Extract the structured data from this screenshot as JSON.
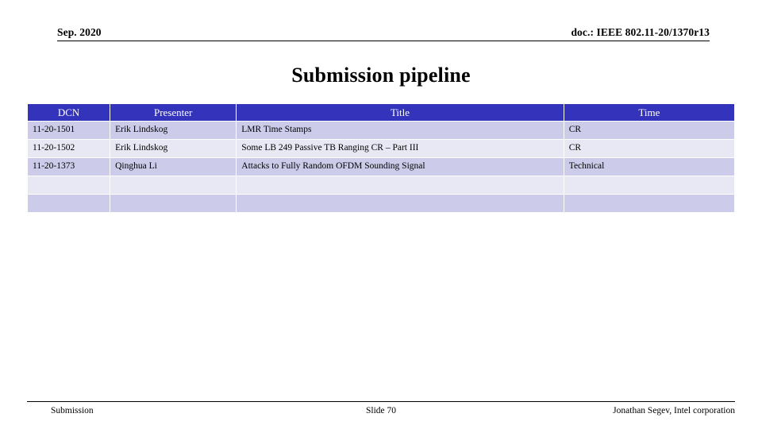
{
  "header": {
    "date": "Sep. 2020",
    "doc_id": "doc.: IEEE 802.11-20/1370r13"
  },
  "title": "Submission pipeline",
  "table": {
    "columns": [
      "DCN",
      "Presenter",
      "Title",
      "Time"
    ],
    "header_bg": "#3333bb",
    "header_fg": "#ffffff",
    "row_color_a": "#ccccea",
    "row_color_b": "#e8e8f4",
    "rows": [
      {
        "dcn": "11-20-1501",
        "presenter": "Erik Lindskog",
        "title": "LMR Time Stamps",
        "time": "CR"
      },
      {
        "dcn": "11-20-1502",
        "presenter": "Erik Lindskog",
        "title": "Some LB 249 Passive TB Ranging CR – Part III",
        "time": "CR"
      },
      {
        "dcn": "11-20-1373",
        "presenter": "Qinghua Li",
        "title": "Attacks to Fully Random OFDM Sounding Signal",
        "time": "Technical"
      },
      {
        "dcn": "",
        "presenter": "",
        "title": "",
        "time": ""
      },
      {
        "dcn": "",
        "presenter": "",
        "title": "",
        "time": ""
      }
    ]
  },
  "footer": {
    "left": "Submission",
    "center": "Slide 70",
    "right": "Jonathan Segev, Intel corporation"
  }
}
